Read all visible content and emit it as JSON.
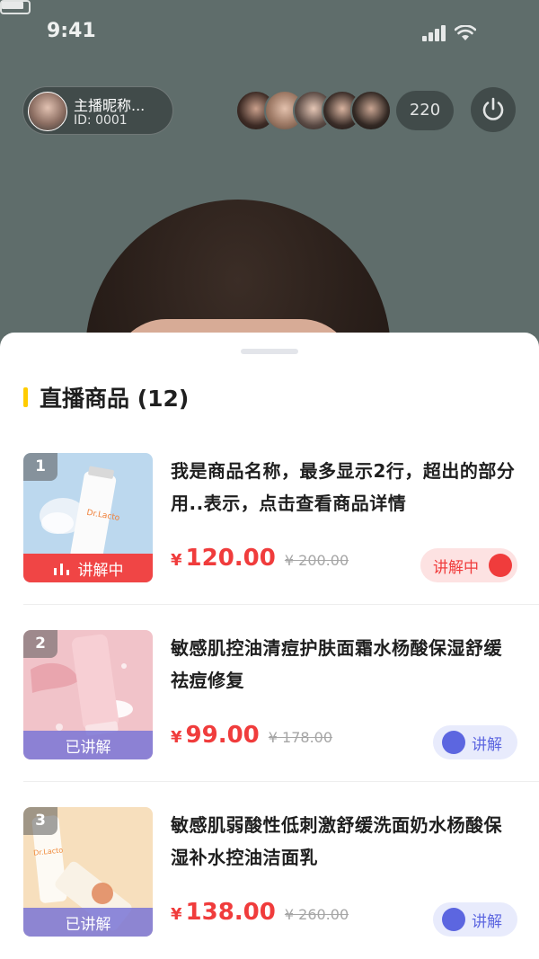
{
  "status_bar": {
    "time": "9:41"
  },
  "host": {
    "name": "主播昵称...",
    "id": "ID: 0001"
  },
  "viewer_count": "220",
  "sheet": {
    "title": "直播商品 (12)"
  },
  "products": [
    {
      "index": "1",
      "name": "我是商品名称，最多显示2行，超出的部分用..表示，点击查看商品详情",
      "currency": "¥",
      "price": "120.00",
      "original_price": "¥ 200.00",
      "status_label": "讲解中",
      "button_label": "讲解中",
      "state": "live"
    },
    {
      "index": "2",
      "name": "敏感肌控油清痘护肤面霜水杨酸保湿舒缓祛痘修复",
      "currency": "¥",
      "price": "99.00",
      "original_price": "¥ 178.00",
      "status_label": "已讲解",
      "button_label": "讲解",
      "state": "done"
    },
    {
      "index": "3",
      "name": "敏感肌弱酸性低刺激舒缓洗面奶水杨酸保湿补水控油洁面乳",
      "currency": "¥",
      "price": "138.00",
      "original_price": "¥ 260.00",
      "status_label": "已讲解",
      "button_label": "讲解",
      "state": "done"
    }
  ],
  "thumb_brand_text": "Dr.Lacto",
  "colors": {
    "accent_red": "#f03c3c",
    "accent_blue": "#5c66e0",
    "title_bar": "#ffcc00"
  }
}
